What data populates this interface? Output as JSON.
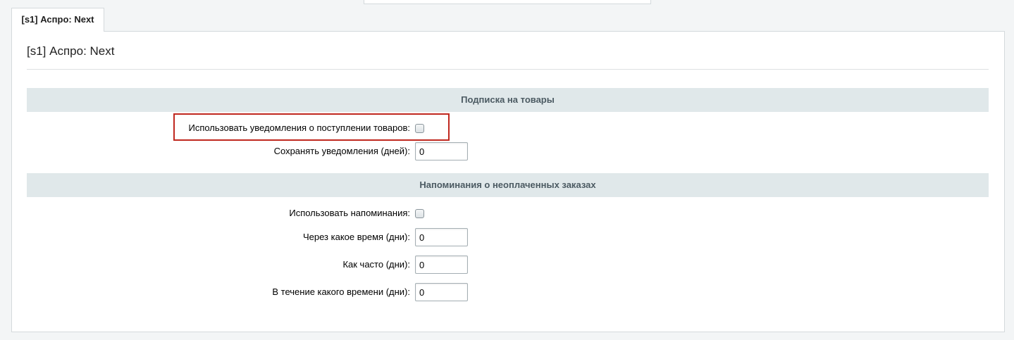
{
  "tabs": [
    {
      "label": "[s1] Аспро: Next",
      "active": true
    }
  ],
  "panel": {
    "title": "[s1] Аспро: Next"
  },
  "sections": [
    {
      "header": "Подписка на товары",
      "fields": [
        {
          "label": "Использовать уведомления о поступлении товаров:",
          "type": "checkbox",
          "checked": false,
          "highlighted": true
        },
        {
          "label": "Сохранять уведомления (дней):",
          "type": "text",
          "value": "0"
        }
      ]
    },
    {
      "header": "Напоминания о неоплаченных заказах",
      "fields": [
        {
          "label": "Использовать напоминания:",
          "type": "checkbox",
          "checked": false
        },
        {
          "label": "Через какое время (дни):",
          "type": "text",
          "value": "0"
        },
        {
          "label": "Как часто (дни):",
          "type": "text",
          "value": "0"
        },
        {
          "label": "В течение какого времени (дни):",
          "type": "text",
          "value": "0"
        }
      ]
    }
  ],
  "colors": {
    "section_header_bg": "#e0e8ea",
    "highlight_border": "#c0281f",
    "panel_border": "#d4d9dc"
  }
}
